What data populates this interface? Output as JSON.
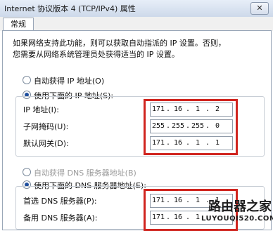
{
  "window": {
    "title": "Internet 协议版本 4 (TCP/IPv4) 属性",
    "close_glyph": "✕"
  },
  "tabs": [
    {
      "label": "常规"
    }
  ],
  "description": [
    "如果网络支持此功能，则可以获取自动指派的 IP 设置。否则，",
    "您需要从网络系统管理员处获得适当的 IP 设置。"
  ],
  "ip_settings": {
    "auto_label": "自动获得 IP 地址(O)",
    "manual_label": "使用下面的 IP 地址(S):",
    "selected": "manual",
    "fields": [
      {
        "label": "IP 地址(I):",
        "octets": [
          "171",
          "16",
          "1",
          "2"
        ]
      },
      {
        "label": "子网掩码(U):",
        "octets": [
          "255",
          "255",
          "255",
          "0"
        ]
      },
      {
        "label": "默认网关(D):",
        "octets": [
          "171",
          "16",
          "1",
          "1"
        ]
      }
    ]
  },
  "dns_settings": {
    "auto_label": "自动获得 DNS 服务器地址(B)",
    "manual_label": "使用下面的 DNS 服务器地址(E):",
    "selected": "manual",
    "fields": [
      {
        "label": "首选 DNS 服务器(P):",
        "octets": [
          "171",
          "16",
          "1",
          "1"
        ]
      },
      {
        "label": "备用 DNS 服务器(A):",
        "octets": [
          "171",
          "16",
          "1",
          ""
        ]
      }
    ]
  },
  "watermark": {
    "line1": "路由器之家",
    "line2": "LUYOUQI520.COM"
  },
  "colors": {
    "highlight_box": "#d0251f",
    "titlebar": "#cdd9ea"
  }
}
